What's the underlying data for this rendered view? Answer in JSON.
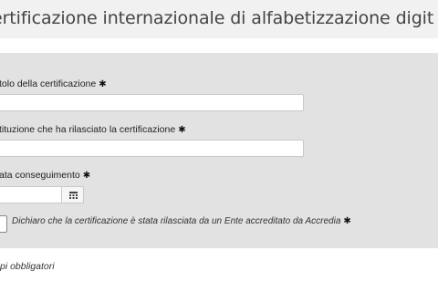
{
  "page": {
    "title": "ertificazione internazionale di alfabetizzazione digit"
  },
  "form": {
    "required_marker": "✱",
    "fields": [
      {
        "label": "tolo della certificazione",
        "value": ""
      },
      {
        "label": "tituzione che ha rilasciato la certificazione",
        "value": ""
      },
      {
        "label": "ata conseguimento",
        "value": ""
      }
    ],
    "calendar_icon": "calendar-icon",
    "declaration": {
      "text": "Dichiaro che la certificazione è stata rilasciata da un Ente accreditato da Accredia",
      "checked": false
    },
    "required_note": "pi obbligatori"
  },
  "colors": {
    "title_bar_bg": "#f1f1f1",
    "panel_bg": "#e2e2e2",
    "input_bg": "#ffffff",
    "text": "#222222"
  }
}
